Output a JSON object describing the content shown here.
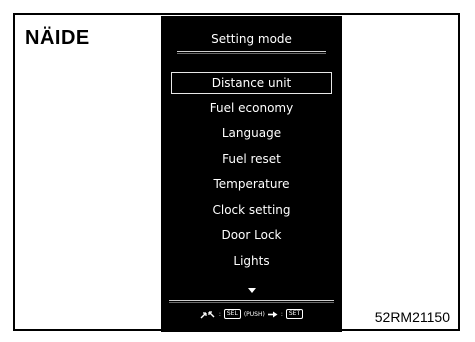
{
  "example_label": "NÄIDE",
  "figure_code": "52RM21150",
  "screen": {
    "title": "Setting mode",
    "menu_items": [
      "Distance unit",
      "Fuel economy",
      "Language",
      "Fuel reset",
      "Temperature",
      "Clock setting",
      "Door Lock",
      "Lights"
    ],
    "selected_index": 0,
    "scroll_indicator_icon": "triangle-down-icon",
    "hint": {
      "select_icon": "rotate-arrows-icon",
      "select_sep": ":",
      "select_key": "SEL",
      "push_label": "(PUSH)",
      "set_icon": "arrow-right-icon",
      "set_sep": ":",
      "set_key": "SET"
    }
  }
}
